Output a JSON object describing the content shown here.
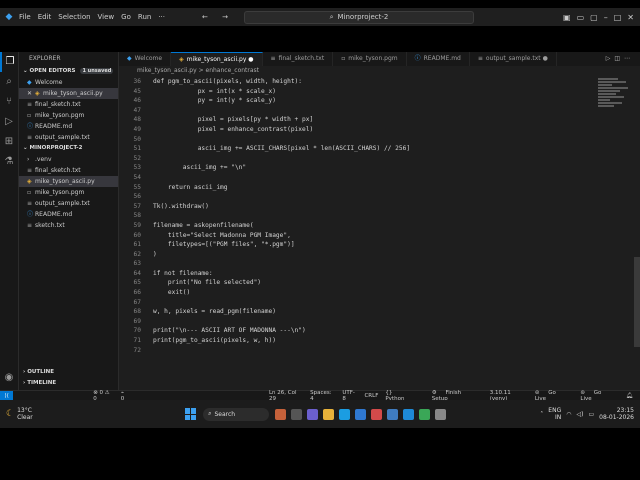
{
  "titlebar": {
    "menu": [
      "File",
      "Edit",
      "Selection",
      "View",
      "Go",
      "Run"
    ],
    "nav": "← →",
    "search": "Minorproject-2",
    "more": "···"
  },
  "activity": [
    "explorer-icon",
    "search-icon",
    "source-control-icon",
    "run-debug-icon",
    "extensions-icon",
    "testing-icon"
  ],
  "sidebar": {
    "title": "EXPLORER",
    "open_editors": "OPEN EDITORS",
    "unsaved": "1 unsaved",
    "open_files": [
      "Welcome",
      "mike_tyson_ascii.py",
      "final_sketch.txt",
      "mike_tyson.pgm",
      "README.md",
      "output_sample.txt"
    ],
    "project": "MINORPROJECT-2",
    "files": [
      ".venv",
      "final_sketch.txt",
      "mike_tyson_ascii.py",
      "mike_tyson.pgm",
      "output_sample.txt",
      "README.md",
      "sketch.txt"
    ],
    "outline": "OUTLINE",
    "timeline": "TIMELINE"
  },
  "tabs": [
    "Welcome",
    "mike_tyson_ascii.py",
    "final_sketch.txt",
    "mike_tyson.pgm",
    "README.md",
    "output_sample.txt"
  ],
  "breadcrumb": "mike_tyson_ascii.py  >  enhance_contrast",
  "code": [
    {
      "n": "36",
      "t": "def pgm_to_ascii(pixels, width, height):"
    },
    {
      "n": "45",
      "t": "            px = int(x * scale_x)"
    },
    {
      "n": "46",
      "t": "            py = int(y * scale_y)"
    },
    {
      "n": "47",
      "t": ""
    },
    {
      "n": "48",
      "t": "            pixel = pixels[py * width + px]"
    },
    {
      "n": "49",
      "t": "            pixel = enhance_contrast(pixel)"
    },
    {
      "n": "50",
      "t": ""
    },
    {
      "n": "51",
      "t": "            ascii_img += ASCII_CHARS[pixel * len(ASCII_CHARS) // 256]"
    },
    {
      "n": "52",
      "t": ""
    },
    {
      "n": "53",
      "t": "        ascii_img += \"\\n\""
    },
    {
      "n": "54",
      "t": ""
    },
    {
      "n": "55",
      "t": "    return ascii_img"
    },
    {
      "n": "56",
      "t": ""
    },
    {
      "n": "57",
      "t": "Tk().withdraw()"
    },
    {
      "n": "58",
      "t": ""
    },
    {
      "n": "59",
      "t": "filename = askopenfilename("
    },
    {
      "n": "60",
      "t": "    title=\"Select Madonna PGM Image\","
    },
    {
      "n": "61",
      "t": "    filetypes=[(\"PGM files\", \"*.pgm\")]"
    },
    {
      "n": "62",
      "t": ")"
    },
    {
      "n": "63",
      "t": ""
    },
    {
      "n": "64",
      "t": "if not filename:"
    },
    {
      "n": "65",
      "t": "    print(\"No file selected\")"
    },
    {
      "n": "66",
      "t": "    exit()"
    },
    {
      "n": "67",
      "t": ""
    },
    {
      "n": "68",
      "t": "w, h, pixels = read_pgm(filename)"
    },
    {
      "n": "69",
      "t": ""
    },
    {
      "n": "70",
      "t": "print(\"\\n--- ASCII ART OF MADONNA ---\\n\")"
    },
    {
      "n": "71",
      "t": "print(pgm_to_ascii(pixels, w, h))"
    },
    {
      "n": "72",
      "t": ""
    }
  ],
  "status": {
    "errors": "⊗ 0 ⚠ 0",
    "ports": "0",
    "position": "Ln 26, Col 29",
    "spaces": "Spaces: 4",
    "encoding": "UTF-8",
    "eol": "CRLF",
    "language": "Python",
    "finish": "Finish Setup",
    "interpreter": "3.10.11 (venv)",
    "golive": "Go Live",
    "golive2": "Go Live"
  },
  "taskbar": {
    "temp": "13°C",
    "weather": "Clear",
    "search": "Search",
    "lang1": "ENG",
    "lang2": "IN",
    "time": "23:15",
    "date": "08-01-2026"
  }
}
